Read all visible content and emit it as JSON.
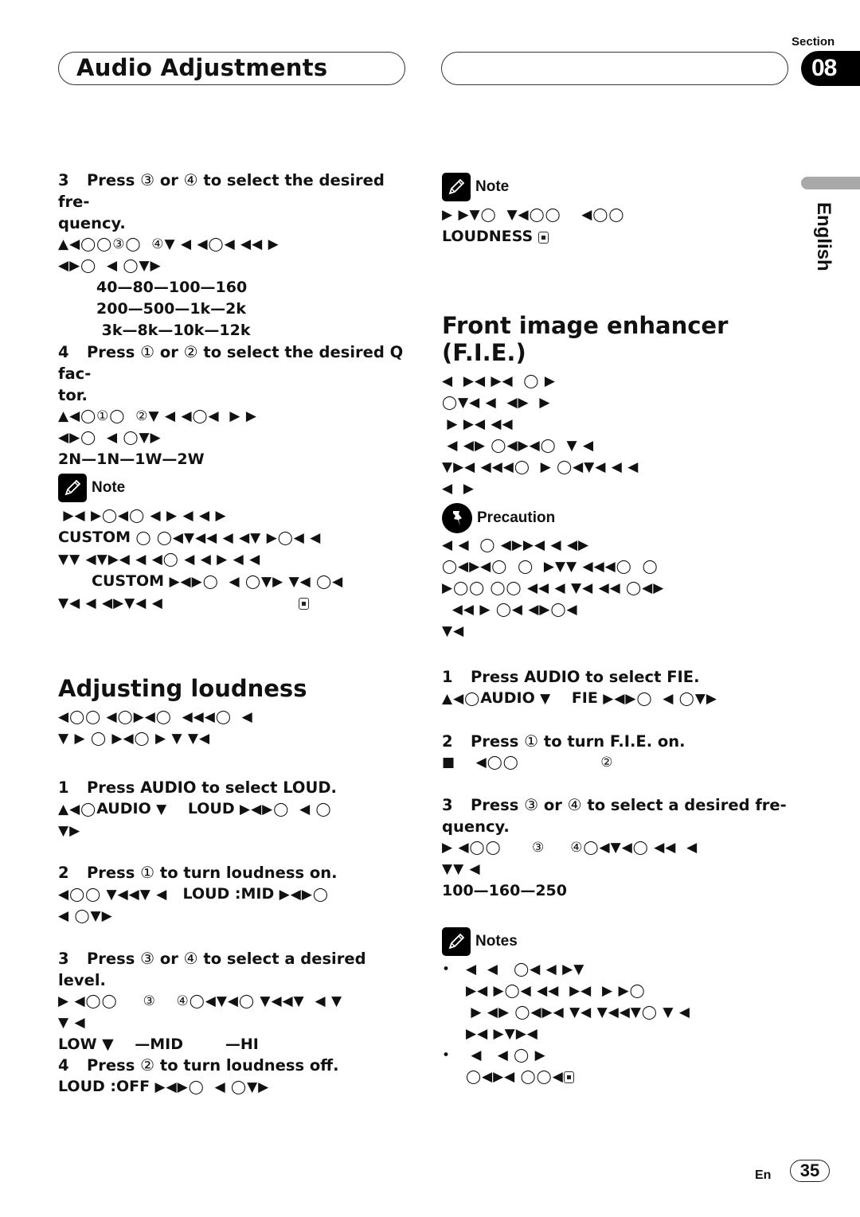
{
  "header": {
    "title": "Audio Adjustments",
    "section_label": "Section",
    "section_number": "08",
    "language_tab": "English"
  },
  "left": {
    "step3_freq": {
      "num": "3",
      "text_a": "Press ",
      "btn_a": "③",
      "text_b": " or ",
      "btn_b": "④",
      "text_c": " to select the desired fre-",
      "text_d": "quency.",
      "glyph1": "▲◀◯◯③◯  ④▼ ◀ ◀◯◀ ◀◀ ▶",
      "glyph2": "◀▶◯  ◀ ◯▼▶",
      "values": [
        "40—80—100—160",
        "200—500—1k—2k",
        " 3k—8k—10k—12k"
      ]
    },
    "step4_q": {
      "num": "4",
      "text_a": "Press ",
      "btn_a": "①",
      "text_b": " or ",
      "btn_b": "②",
      "text_c": " to select the desired Q fac-",
      "text_d": "tor.",
      "glyph1": "▲◀◯①◯  ②▼ ◀ ◀◯◀  ▶ ▶",
      "glyph2": "◀▶◯  ◀ ◯▼▶",
      "values": "2N—1N—1W—2W"
    },
    "note": {
      "heading": "Note",
      "line1": " ▶◀ ▶◯◀◯ ◀ ▶ ◀ ◀ ▶",
      "line2_bold": "CUSTOM",
      "line2": " ◯ ◯◀▼◀◀ ◀ ◀▼ ▶◯◀ ◀",
      "line3": "▼▼ ◀▼▶◀ ◀ ◀◯ ◀ ◀ ▶ ◀ ◀",
      "line4_bold": "CUSTOM",
      "line4": " ▶◀▶◯  ◀ ◯▼▶ ▼◀ ◯◀",
      "line5": "▼◀ ◀ ◀▶▼◀ ◀"
    },
    "loudness": {
      "heading": "Adjusting loudness",
      "intro1": "◀◯◯ ◀◯▶◀◯  ◀◀◀◯  ◀",
      "intro2": "▼ ▶ ◯ ▶◀◯ ▶ ▼ ▼◀",
      "steps": [
        {
          "num": "1",
          "text": "Press AUDIO to select LOUD.",
          "glyph_a": "▲◀◯",
          "bold_a": "AUDIO",
          "glyph_b": " ▼    ",
          "bold_b": "LOUD",
          "glyph_c": " ▶◀▶◯  ◀ ◯",
          "glyph2": "▼▶"
        },
        {
          "num": "2",
          "text_a": "Press ",
          "btn_a": "①",
          "text_b": " to turn loudness on.",
          "glyph_a": "◀◯◯ ▼◀◀▼ ◀   ",
          "bold_a": "LOUD :MID",
          "glyph_b": " ▶◀▶◯",
          "glyph2": "◀ ◯▼▶"
        },
        {
          "num": "3",
          "text_a": "Press ",
          "btn_a": "③",
          "text_b": " or ",
          "btn_b": "④",
          "text_c": " to select a desired level.",
          "glyph1": "▶ ◀◯◯     ③    ④◯◀▼◀◯ ▼◀◀▼  ◀ ▼",
          "glyph2": "▼ ◀",
          "values_a": "LOW",
          "values_glyph": " ▼ ",
          "values_b": "   —MID        —HI"
        },
        {
          "num": "4",
          "text_a": "Press ",
          "btn_a": "②",
          "text_b": " to turn loudness off.",
          "bold_a": "LOUD :OFF",
          "glyph_a": " ▶◀▶◯  ◀ ◯▼▶"
        }
      ]
    }
  },
  "right": {
    "note": {
      "heading": "Note",
      "line1": "▶ ▶▼◯  ▼◀◯◯    ◀◯◯",
      "line2_bold": "LOUDNESS"
    },
    "fie": {
      "heading": "Front image enhancer (F.I.E.)",
      "lines": [
        "◀  ▶◀ ▶◀  ◯ ▶",
        "◯▼◀ ◀  ◀▶  ▶",
        " ▶ ▶◀ ◀◀",
        " ◀ ◀▶ ◯◀▶◀◯  ▼ ◀",
        "▼▶◀ ◀◀◀◯  ▶ ◯◀▼◀ ◀ ◀",
        "◀  ▶"
      ]
    },
    "precaution": {
      "heading": "Precaution",
      "lines": [
        "◀ ◀  ◯ ◀▶▶◀ ◀ ◀▶",
        "◯◀▶◀◯  ◯  ▶▼▼ ◀◀◀◯  ◯",
        "▶◯◯ ◯◯ ◀◀ ◀ ▼◀ ◀◀ ◯◀▶",
        "  ◀◀ ▶ ◯◀ ◀▶◯◀",
        "▼◀"
      ]
    },
    "steps": [
      {
        "num": "1",
        "text": "Press AUDIO to select FIE.",
        "glyph_a": "▲◀◯",
        "bold_a": "AUDIO",
        "glyph_b": " ▼    ",
        "bold_b": "FIE",
        "glyph_c": " ▶◀▶◯  ◀ ◯▼▶"
      },
      {
        "num": "2",
        "text_a": "Press ",
        "btn_a": "①",
        "text_b": " to turn F.I.E. on.",
        "glyph1": "■    ◀◯◯                ②"
      },
      {
        "num": "3",
        "text_a": "Press ",
        "btn_a": "③",
        "text_b": " or ",
        "btn_b": "④",
        "text_c": " to select a desired fre-",
        "text_d": "quency.",
        "glyph1": "▶ ◀◯◯      ③     ④◯◀▼◀◯ ◀◀  ◀",
        "glyph2": "▼▼ ◀",
        "values": "100—160—250"
      }
    ],
    "notes": {
      "heading": "Notes",
      "bullets": [
        {
          "bullet": "•",
          "lines": [
            "◀  ◀   ◯◀ ◀ ▶▼",
            "▶◀ ▶◯◀ ◀◀  ▶◀  ▶ ▶◯",
            " ▶ ◀▶ ◯◀▶◀ ▼◀ ▼◀◀▼◯ ▼ ◀",
            "▶◀ ▶▼▶◀"
          ]
        },
        {
          "bullet": "•",
          "lines": [
            " ◀   ◀ ◯ ▶",
            "◯◀▶◀ ◯◯◀"
          ]
        }
      ]
    }
  },
  "footer": {
    "lang_code": "En",
    "page_number": "35"
  }
}
